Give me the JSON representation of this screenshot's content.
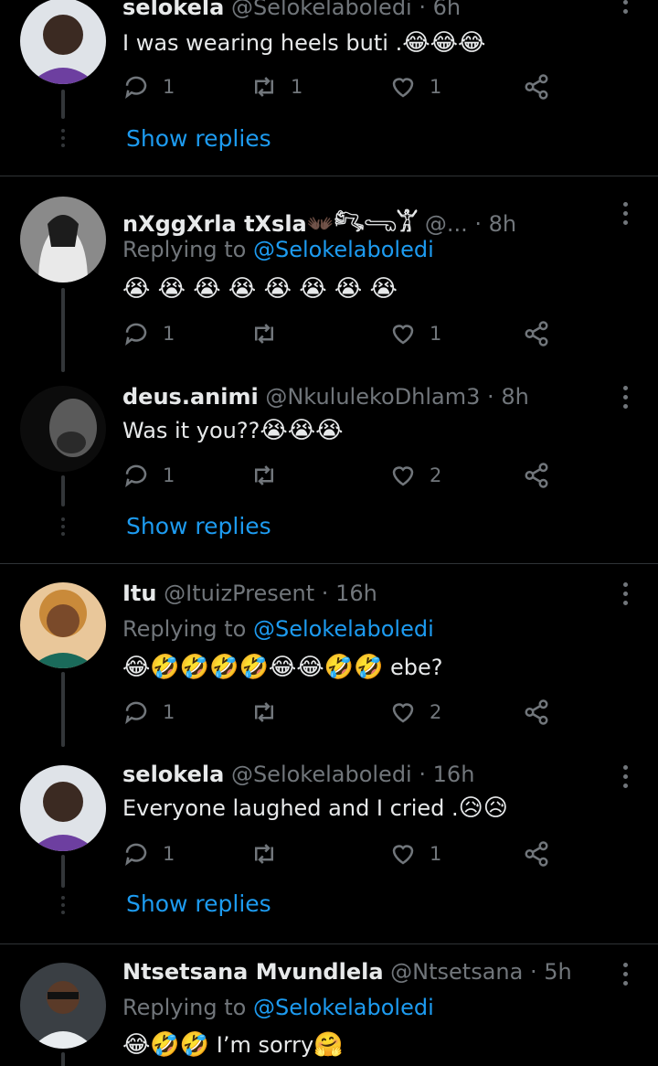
{
  "tweets": [
    {
      "name": "selokela",
      "handle": "@Selokelaboledi",
      "sep": "·",
      "time": "6h",
      "replying_prefix": "",
      "replying_mention": "",
      "text": "I was wearing heels buti .",
      "emojis": "😂😂😂",
      "reply_count": "1",
      "retweet_count": "1",
      "like_count": "1"
    },
    {
      "name": "nXggXrla tXsla",
      "name_suffix": "👐🏿𓀐𓂸𓀠",
      "handle": "@...",
      "sep": "·",
      "time": "8h",
      "replying_prefix": "Replying to",
      "replying_mention": "@Selokelaboledi",
      "text": "",
      "emojis": "😭 😭 😭 😭 😭 😭 😭 😭",
      "reply_count": "1",
      "retweet_count": "",
      "like_count": "1"
    },
    {
      "name": "deus.animi",
      "handle": "@NkululekoDhlam3",
      "sep": "·",
      "time": "8h",
      "replying_prefix": "",
      "replying_mention": "",
      "text": "Was it you??",
      "emojis": "😭😭😭",
      "reply_count": "1",
      "retweet_count": "",
      "like_count": "2"
    },
    {
      "name": "Itu",
      "handle": "@ItuizPresent",
      "sep": "·",
      "time": "16h",
      "replying_prefix": "Replying to",
      "replying_mention": "@Selokelaboledi",
      "text": "",
      "emojis": "😂🤣🤣🤣🤣😂😂🤣🤣",
      "text_after": " ebe?",
      "reply_count": "1",
      "retweet_count": "",
      "like_count": "2"
    },
    {
      "name": "selokela",
      "handle": "@Selokelaboledi",
      "sep": "·",
      "time": "16h",
      "replying_prefix": "",
      "replying_mention": "",
      "text": "Everyone laughed and I cried .",
      "emojis": "😥😥",
      "reply_count": "1",
      "retweet_count": "",
      "like_count": "1"
    },
    {
      "name": "Ntsetsana Mvundlela",
      "handle": "@Ntsetsana",
      "sep": "·",
      "time": "5h",
      "replying_prefix": "Replying to",
      "replying_mention": "@Selokelaboledi",
      "text": "",
      "emojis": "😂🤣🤣",
      "text_after": " I’m sorry",
      "emoji_after": "🤗"
    }
  ],
  "show_replies_label": "Show replies",
  "colors": {
    "background": "#000000",
    "link": "#1d9bf0",
    "muted": "#71767b",
    "text": "#e7e9ea",
    "divider": "#2f3336"
  }
}
